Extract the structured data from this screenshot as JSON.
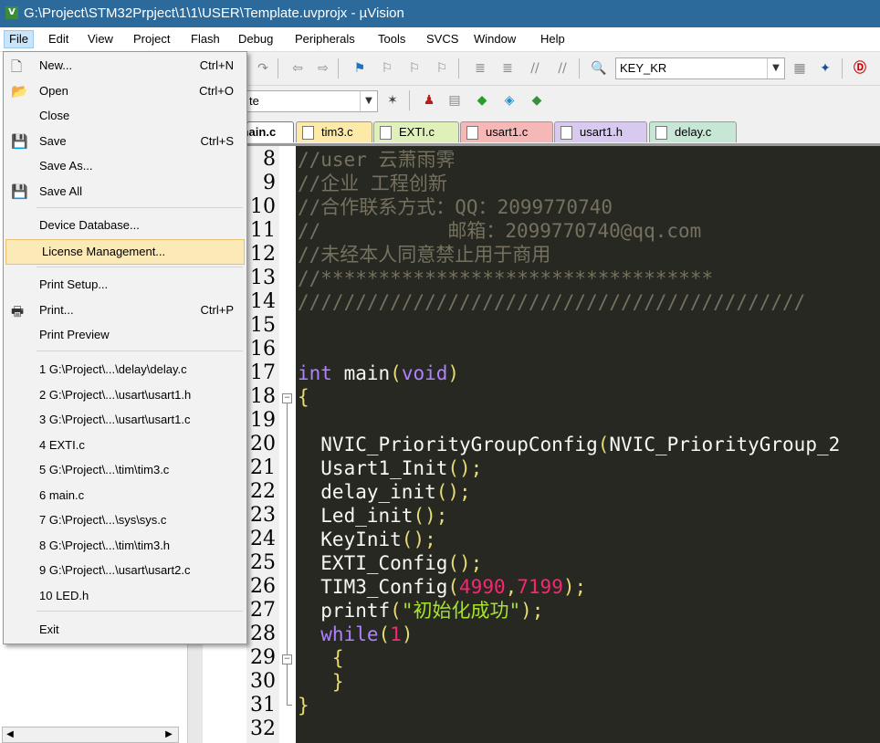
{
  "window": {
    "title": "G:\\Project\\STM32Prpject\\1\\1\\USER\\Template.uvprojx - µVision",
    "app_icon_glyph": "V"
  },
  "menubar": [
    {
      "label": "File",
      "open": true
    },
    {
      "label": "Edit"
    },
    {
      "label": "View"
    },
    {
      "label": "Project"
    },
    {
      "label": "Flash"
    },
    {
      "label": "Debug"
    },
    {
      "label": "Peripherals"
    },
    {
      "label": "Tools"
    },
    {
      "label": "SVCS"
    },
    {
      "label": "Window"
    },
    {
      "label": "Help"
    }
  ],
  "toolbar": {
    "find_combo_value": "KEY_KR",
    "target_combo_value": "te"
  },
  "file_menu": {
    "items": [
      {
        "label": "New...",
        "shortcut": "Ctrl+N",
        "icon": "new-file-icon"
      },
      {
        "label": "Open",
        "shortcut": "Ctrl+O",
        "icon": "open-folder-icon"
      },
      {
        "label": "Close",
        "shortcut": ""
      },
      {
        "label": "Save",
        "shortcut": "Ctrl+S",
        "icon": "save-icon"
      },
      {
        "label": "Save As...",
        "shortcut": ""
      },
      {
        "label": "Save All",
        "shortcut": "",
        "icon": "save-all-icon"
      },
      {
        "label": "Device Database...",
        "shortcut": ""
      },
      {
        "label": "License Management...",
        "shortcut": "",
        "highlighted": true
      },
      {
        "label": "Print Setup...",
        "shortcut": ""
      },
      {
        "label": "Print...",
        "shortcut": "Ctrl+P",
        "icon": "printer-icon"
      },
      {
        "label": "Print Preview",
        "shortcut": ""
      },
      {
        "label": "1 G:\\Project\\...\\delay\\delay.c"
      },
      {
        "label": "2 G:\\Project\\...\\usart\\usart1.h"
      },
      {
        "label": "3 G:\\Project\\...\\usart\\usart1.c"
      },
      {
        "label": "4 EXTI.c"
      },
      {
        "label": "5 G:\\Project\\...\\tim\\tim3.c"
      },
      {
        "label": "6 main.c"
      },
      {
        "label": "7 G:\\Project\\...\\sys\\sys.c"
      },
      {
        "label": "8 G:\\Project\\...\\tim\\tim3.h"
      },
      {
        "label": "9 G:\\Project\\...\\usart\\usart2.c"
      },
      {
        "label": "10 LED.h"
      },
      {
        "label": "Exit"
      }
    ]
  },
  "editor_tabs": [
    {
      "label": "main.c",
      "color": "#ffffff",
      "active": true
    },
    {
      "label": "tim3.c",
      "color": "#fde9a8"
    },
    {
      "label": "EXTI.c",
      "color": "#dff0b8"
    },
    {
      "label": "usart1.c",
      "color": "#f6b7b7"
    },
    {
      "label": "usart1.h",
      "color": "#d8c9f0"
    },
    {
      "label": "delay.c",
      "color": "#c6e6d6"
    }
  ],
  "line_numbers": [
    "8",
    "9",
    "10",
    "11",
    "12",
    "13",
    "14",
    "15",
    "16",
    "17",
    "18",
    "19",
    "20",
    "21",
    "22",
    "23",
    "24",
    "25",
    "26",
    "27",
    "28",
    "29",
    "30",
    "31",
    "32"
  ],
  "code_lines": [
    {
      "segments": [
        {
          "text": "//user 云萧雨霁",
          "color": "#75715e"
        }
      ]
    },
    {
      "segments": [
        {
          "text": "//企业 工程创新",
          "color": "#75715e"
        }
      ]
    },
    {
      "segments": [
        {
          "text": "//合作联系方式：QQ：2099770740",
          "color": "#75715e"
        }
      ]
    },
    {
      "segments": [
        {
          "text": "//           邮箱：2099770740@qq.com",
          "color": "#75715e"
        }
      ]
    },
    {
      "segments": [
        {
          "text": "//未经本人同意禁止用于商用",
          "color": "#75715e"
        }
      ]
    },
    {
      "segments": [
        {
          "text": "//**********************************",
          "color": "#75715e"
        }
      ]
    },
    {
      "segments": [
        {
          "text": "////////////////////////////////////////////",
          "color": "#75715e"
        }
      ]
    },
    {
      "segments": []
    },
    {
      "segments": []
    },
    {
      "segments": [
        {
          "text": "int",
          "color": "#ae81ff"
        },
        {
          "text": " main",
          "color": "#f8f8f2"
        },
        {
          "text": "(",
          "color": "#e6db74"
        },
        {
          "text": "void",
          "color": "#ae81ff"
        },
        {
          "text": ")",
          "color": "#e6db74"
        }
      ]
    },
    {
      "segments": [
        {
          "text": "{",
          "color": "#e6db74"
        }
      ]
    },
    {
      "segments": []
    },
    {
      "segments": [
        {
          "text": "  NVIC_PriorityGroupConfig",
          "color": "#f8f8f2"
        },
        {
          "text": "(",
          "color": "#e6db74"
        },
        {
          "text": "NVIC_PriorityGroup_2",
          "color": "#f8f8f2"
        }
      ]
    },
    {
      "segments": [
        {
          "text": "  Usart1_Init",
          "color": "#f8f8f2"
        },
        {
          "text": "();",
          "color": "#e6db74"
        }
      ]
    },
    {
      "segments": [
        {
          "text": "  delay_init",
          "color": "#f8f8f2"
        },
        {
          "text": "();",
          "color": "#e6db74"
        }
      ]
    },
    {
      "segments": [
        {
          "text": "  Led_init",
          "color": "#f8f8f2"
        },
        {
          "text": "();",
          "color": "#e6db74"
        }
      ]
    },
    {
      "segments": [
        {
          "text": "  KeyInit",
          "color": "#f8f8f2"
        },
        {
          "text": "();",
          "color": "#e6db74"
        }
      ]
    },
    {
      "segments": [
        {
          "text": "  EXTI_Config",
          "color": "#f8f8f2"
        },
        {
          "text": "();",
          "color": "#e6db74"
        }
      ]
    },
    {
      "segments": [
        {
          "text": "  TIM3_Config",
          "color": "#f8f8f2"
        },
        {
          "text": "(",
          "color": "#e6db74"
        },
        {
          "text": "4990",
          "color": "#f92672"
        },
        {
          "text": ",",
          "color": "#e6db74"
        },
        {
          "text": "7199",
          "color": "#f92672"
        },
        {
          "text": ");",
          "color": "#e6db74"
        }
      ]
    },
    {
      "segments": [
        {
          "text": "  printf",
          "color": "#f8f8f2"
        },
        {
          "text": "(",
          "color": "#e6db74"
        },
        {
          "text": "\"初始化成功\"",
          "color": "#a6e22e"
        },
        {
          "text": ");",
          "color": "#e6db74"
        }
      ]
    },
    {
      "segments": [
        {
          "text": "  while",
          "color": "#ae81ff"
        },
        {
          "text": "(",
          "color": "#e6db74"
        },
        {
          "text": "1",
          "color": "#f92672"
        },
        {
          "text": ")",
          "color": "#e6db74"
        }
      ]
    },
    {
      "segments": [
        {
          "text": "   {",
          "color": "#e6db74"
        }
      ]
    },
    {
      "segments": [
        {
          "text": "   }",
          "color": "#e6db74"
        }
      ]
    },
    {
      "segments": [
        {
          "text": "}",
          "color": "#e6db74"
        }
      ]
    },
    {
      "segments": []
    }
  ]
}
